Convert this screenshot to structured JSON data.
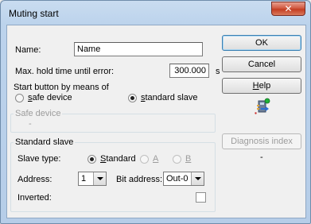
{
  "window": {
    "title": "Muting start",
    "close_glyph": "✕"
  },
  "form": {
    "name_label": "Name:",
    "name_value": "Name",
    "max_hold_label": "Max. hold time until error:",
    "max_hold_value": "300.000",
    "max_hold_unit": "s"
  },
  "start_button_group": {
    "legend": "Start button by means of",
    "options": [
      {
        "label": "safe device",
        "checked": false
      },
      {
        "label": "standard slave",
        "checked": true
      }
    ]
  },
  "safe_device_group": {
    "legend": "Safe device",
    "value": "-"
  },
  "standard_slave_group": {
    "legend": "Standard slave",
    "slave_type_label": "Slave type:",
    "slave_type_options": [
      {
        "label": "Standard",
        "checked": true,
        "enabled": true
      },
      {
        "label": "A",
        "checked": false,
        "enabled": false
      },
      {
        "label": "B",
        "checked": false,
        "enabled": false
      }
    ],
    "address_label": "Address:",
    "address_value": "1",
    "bit_address_label": "Bit address:",
    "bit_address_value": "Out-0",
    "inverted_label": "Inverted:",
    "inverted_checked": false
  },
  "buttons": {
    "ok": "OK",
    "cancel": "Cancel",
    "help": "Help",
    "diagnosis_index": "Diagnosis index",
    "diagnosis_value": "-"
  },
  "icons": {
    "device_status_icon": "module-with-green-indicator"
  }
}
